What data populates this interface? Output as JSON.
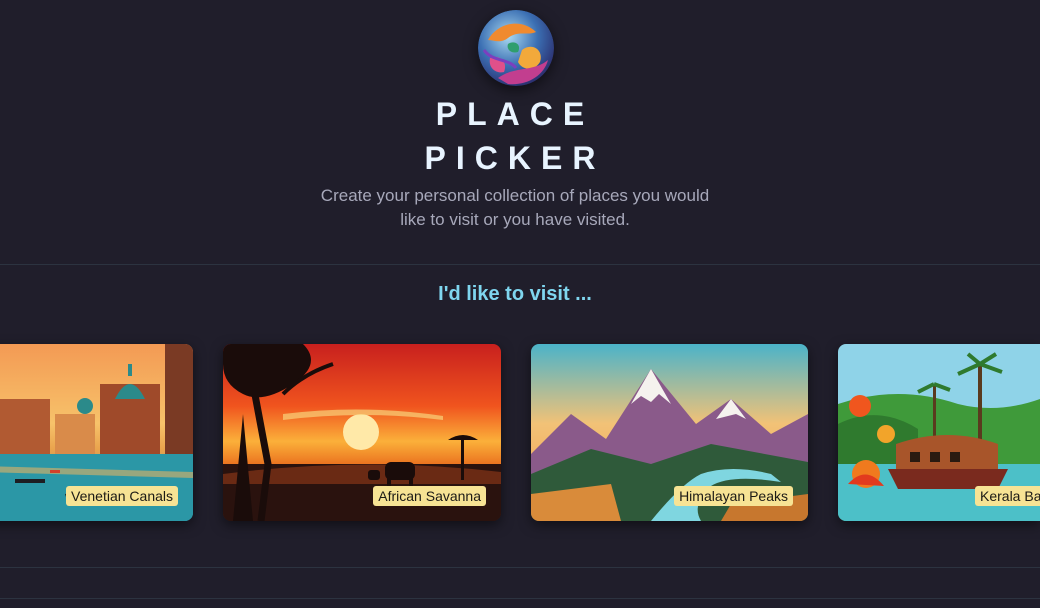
{
  "header": {
    "logo_icon": "globe-icon",
    "title_line1": "PLACE",
    "title_line2": "PICKER",
    "subtitle": "Create your personal collection of places you would like to visit or you have visited."
  },
  "section": {
    "title": "I'd like to visit ..."
  },
  "places": [
    {
      "label": "Venetian Canals",
      "image_icon": "venice-canal-image"
    },
    {
      "label": "African Savanna",
      "image_icon": "savanna-sunset-image"
    },
    {
      "label": "Himalayan Peaks",
      "image_icon": "mountain-peaks-image"
    },
    {
      "label": "Kerala Backwaters",
      "image_icon": "kerala-houseboat-image"
    }
  ],
  "colors": {
    "background": "#201e2b",
    "title": "#e8f4ff",
    "section_title": "#7fd6ef",
    "label_bg": "#f7e394"
  }
}
